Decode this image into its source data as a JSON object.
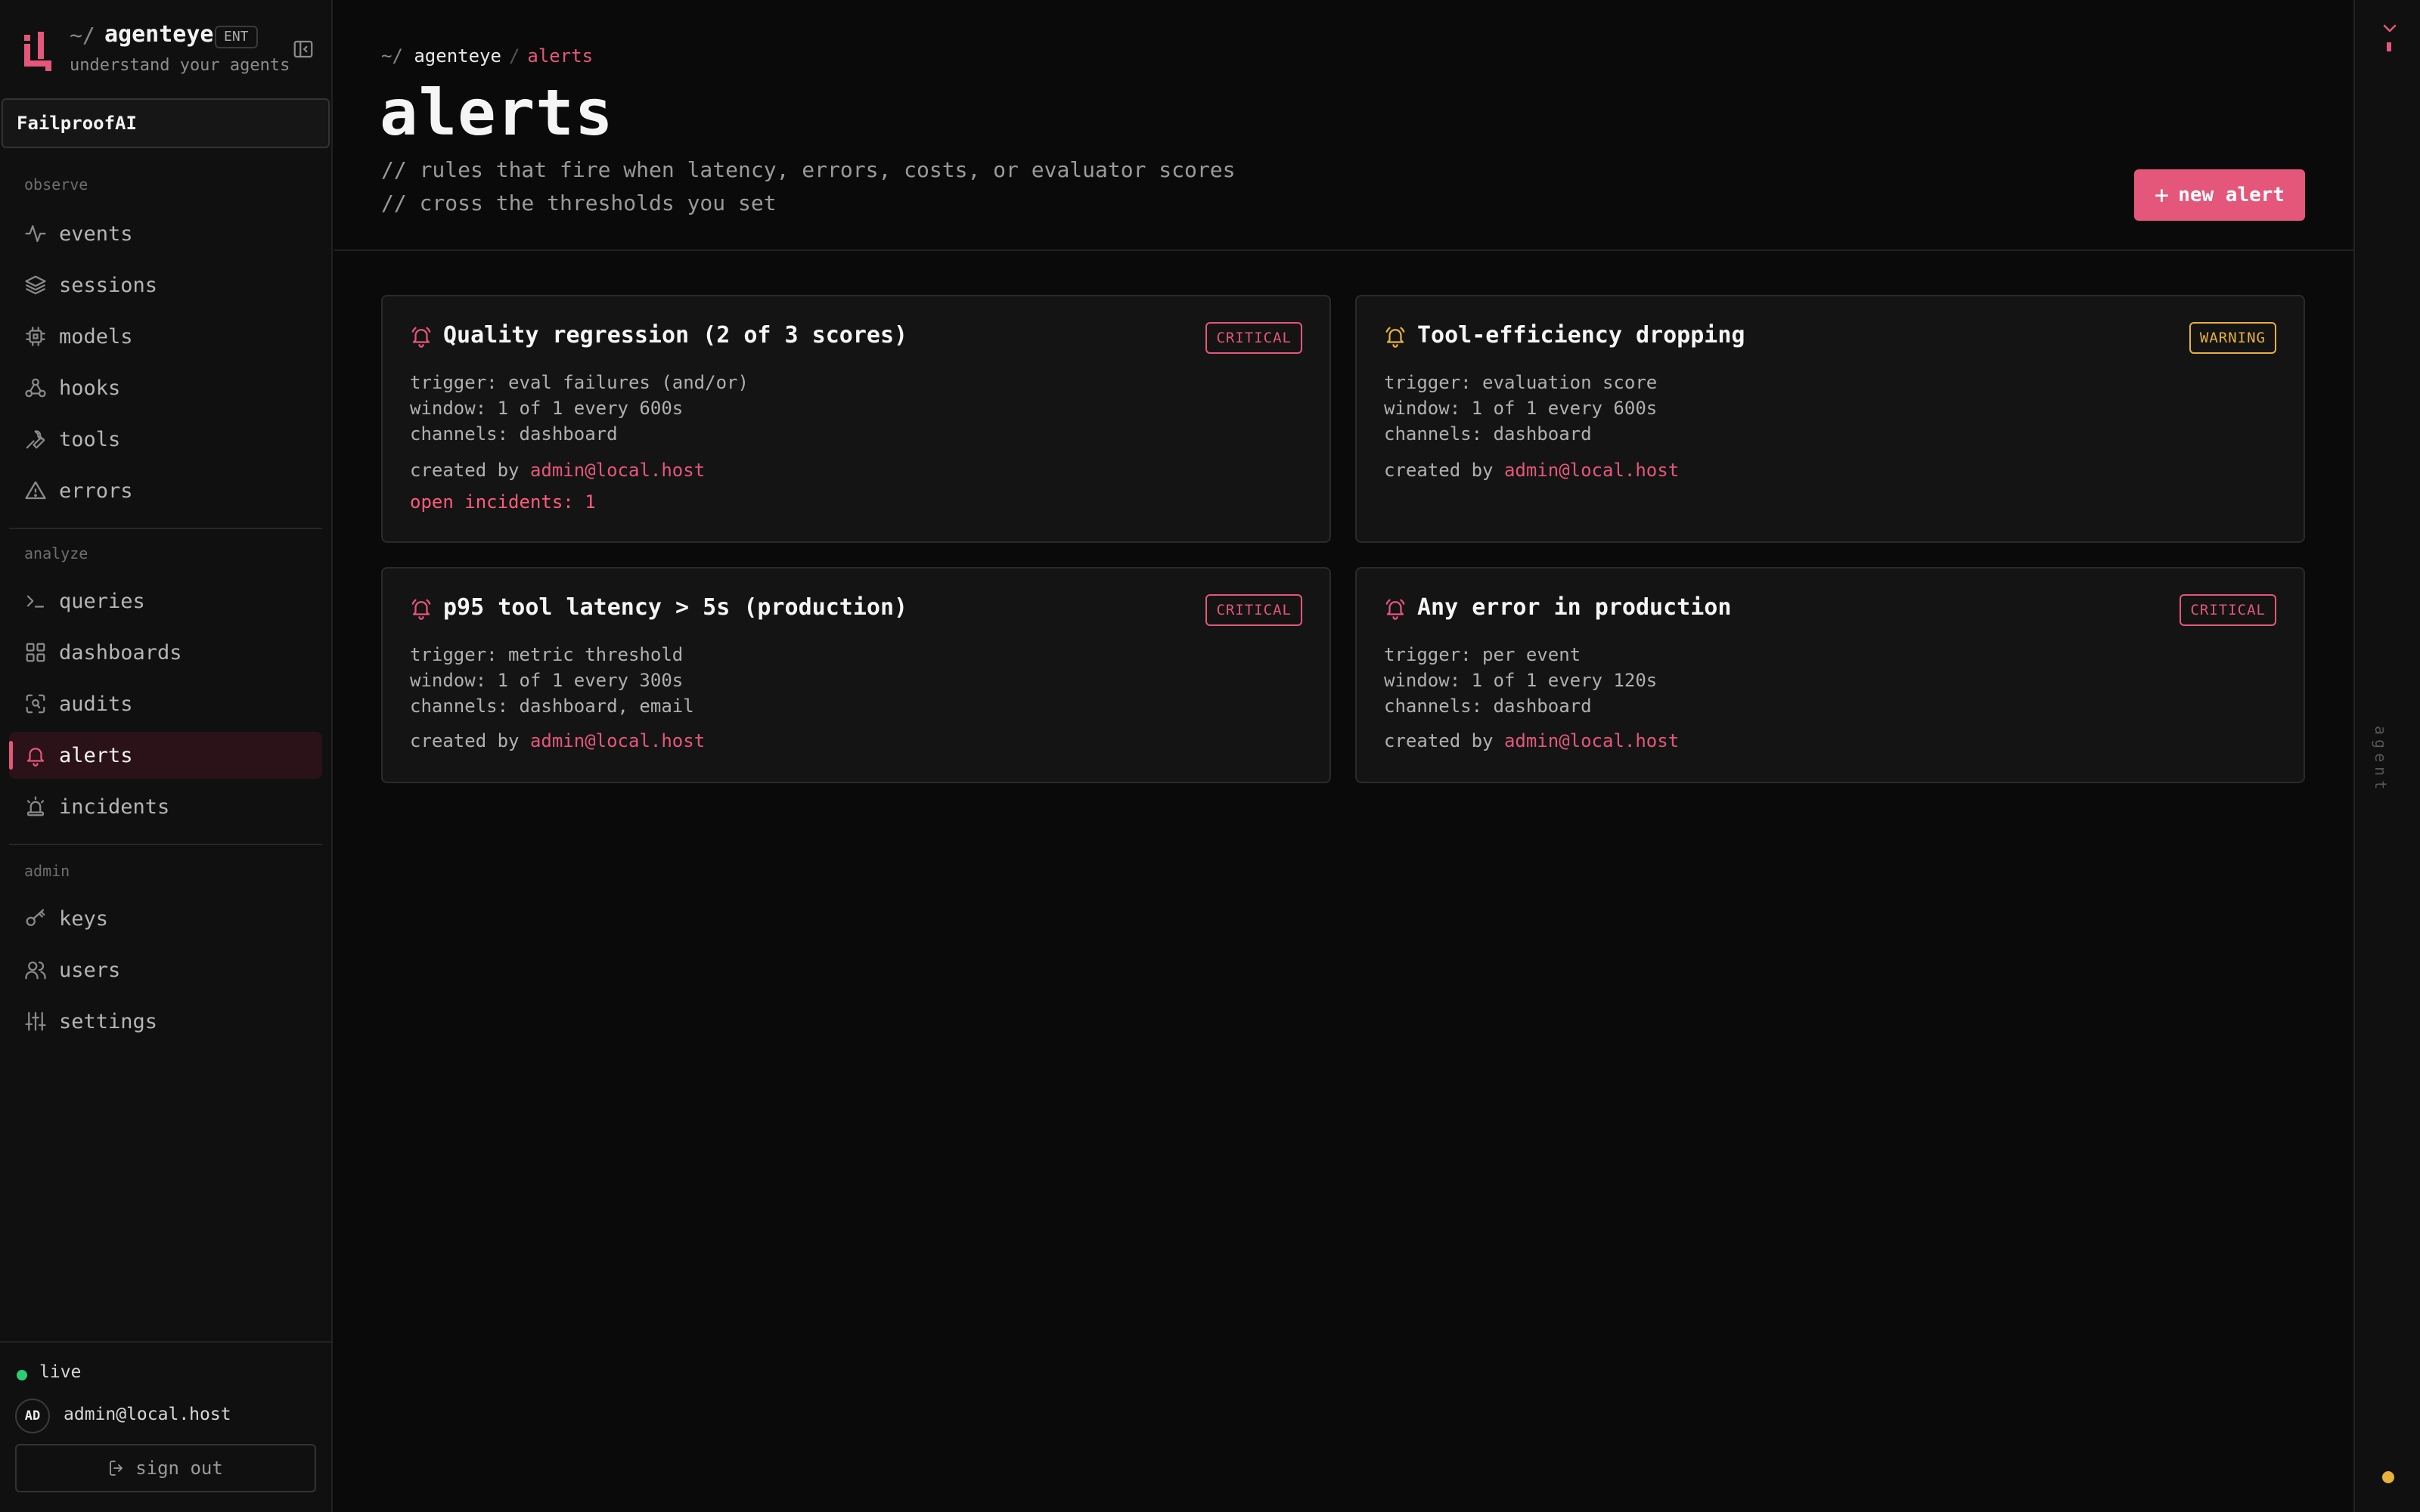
{
  "brand": {
    "prefix": "~/",
    "name": "agenteye",
    "badge": "ENT",
    "tagline": "understand your agents",
    "accent": "#e4577a"
  },
  "org": {
    "selected": "FailproofAI"
  },
  "sidebar": {
    "sections": [
      {
        "label": "observe",
        "items": [
          {
            "label": "events",
            "icon": "activity-icon"
          },
          {
            "label": "sessions",
            "icon": "layers-icon"
          },
          {
            "label": "models",
            "icon": "cpu-icon"
          },
          {
            "label": "hooks",
            "icon": "webhook-icon"
          },
          {
            "label": "tools",
            "icon": "wrench-icon"
          },
          {
            "label": "errors",
            "icon": "warning-icon"
          }
        ]
      },
      {
        "label": "analyze",
        "items": [
          {
            "label": "queries",
            "icon": "terminal-icon"
          },
          {
            "label": "dashboards",
            "icon": "grid-icon"
          },
          {
            "label": "audits",
            "icon": "scan-icon"
          },
          {
            "label": "alerts",
            "icon": "bell-icon",
            "active": true
          },
          {
            "label": "incidents",
            "icon": "siren-icon"
          }
        ]
      },
      {
        "label": "admin",
        "items": [
          {
            "label": "keys",
            "icon": "key-icon"
          },
          {
            "label": "users",
            "icon": "users-icon"
          },
          {
            "label": "settings",
            "icon": "sliders-icon"
          }
        ]
      }
    ],
    "footer": {
      "status": "live",
      "status_color": "#2ecc71",
      "avatar_initials": "AD",
      "user_email": "admin@local.host",
      "sign_out": "sign out"
    }
  },
  "header": {
    "breadcrumb": {
      "prefix": "~/",
      "root": "agenteye",
      "sep": "/",
      "current": "alerts"
    },
    "title": "alerts",
    "subtitle_lines": [
      "// rules that fire when latency, errors, costs, or evaluator scores",
      "// cross the thresholds you set"
    ],
    "new_alert_label": "new alert"
  },
  "alerts": [
    {
      "title": "Quality regression (2 of 3 scores)",
      "severity": "CRITICAL",
      "trigger": "trigger: eval failures (and/or)",
      "window": "window: 1 of 1 every 600s",
      "channels": "channels: dashboard",
      "created_prefix": "created by ",
      "created_by": "admin@local.host",
      "open_incidents": "open incidents: 1"
    },
    {
      "title": "Tool-efficiency dropping",
      "severity": "WARNING",
      "trigger": "trigger: evaluation score",
      "window": "window: 1 of 1 every 600s",
      "channels": "channels: dashboard",
      "created_prefix": "created by ",
      "created_by": "admin@local.host"
    },
    {
      "title": "p95 tool latency > 5s (production)",
      "severity": "CRITICAL",
      "trigger": "trigger: metric threshold",
      "window": "window: 1 of 1 every 300s",
      "channels": "channels: dashboard, email",
      "created_prefix": "created by ",
      "created_by": "admin@local.host"
    },
    {
      "title": "Any error in production",
      "severity": "CRITICAL",
      "trigger": "trigger: per event",
      "window": "window: 1 of 1 every 120s",
      "channels": "channels: dashboard",
      "created_prefix": "created by ",
      "created_by": "admin@local.host"
    }
  ],
  "rail": {
    "label": "agent",
    "indicator_color": "#e8b13c"
  },
  "colors": {
    "critical": "#e4577a",
    "warning": "#e8b13c"
  }
}
